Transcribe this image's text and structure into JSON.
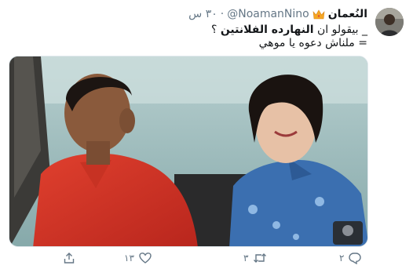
{
  "author": {
    "display_name": "النُعمان",
    "handle": "@NoamanNino",
    "separator": "·",
    "time": "٣٠ س"
  },
  "tweet_text": {
    "line1_prefix": "_ بيقولو ان",
    "line1_bold": "النهارده الفلانتين",
    "line1_suffix": "؟",
    "line2": "= ملناش دعوه يا موهي"
  },
  "actions": {
    "reply_icon": "reply-icon",
    "reply_count": "٢",
    "retweet_icon": "retweet-icon",
    "retweet_count": "٣",
    "like_icon": "heart-icon",
    "like_count": "١٣",
    "share_icon": "share-icon"
  },
  "colors": {
    "text_primary": "#14171a",
    "text_secondary": "#657786",
    "crown": "#f5a623"
  }
}
